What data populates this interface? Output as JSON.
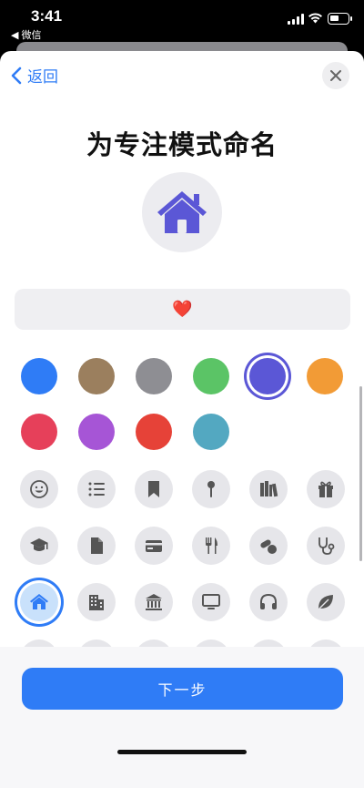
{
  "status_bar": {
    "time": "3:41",
    "back_app": "◀ 微信"
  },
  "nav": {
    "back_label": "返回"
  },
  "title": "为专注模式命名",
  "name_field": {
    "value": "❤️"
  },
  "colors": {
    "blue": "#2f7cf6",
    "brown": "#9b7f5e",
    "gray": "#8e8e93",
    "green": "#5bc466",
    "indigo": "#5b57d6",
    "orange": "#f29b36",
    "pink": "#e6405a",
    "purple": "#a655d6",
    "red": "#e64238",
    "teal": "#53a8c1",
    "selected": "indigo"
  },
  "icons": {
    "row1": [
      "smiley-icon",
      "list-icon",
      "bookmark-icon",
      "pin-icon",
      "books-icon",
      "gift-icon"
    ],
    "row2": [
      "graduation-cap-icon",
      "document-icon",
      "credit-card-icon",
      "fork-knife-icon",
      "pills-icon",
      "stethoscope-icon"
    ],
    "row3": [
      "house-icon",
      "building-icon",
      "bank-icon",
      "monitor-icon",
      "headphones-icon",
      "leaf-icon"
    ],
    "selected": "house-icon"
  },
  "footer": {
    "next_label": "下一步"
  }
}
